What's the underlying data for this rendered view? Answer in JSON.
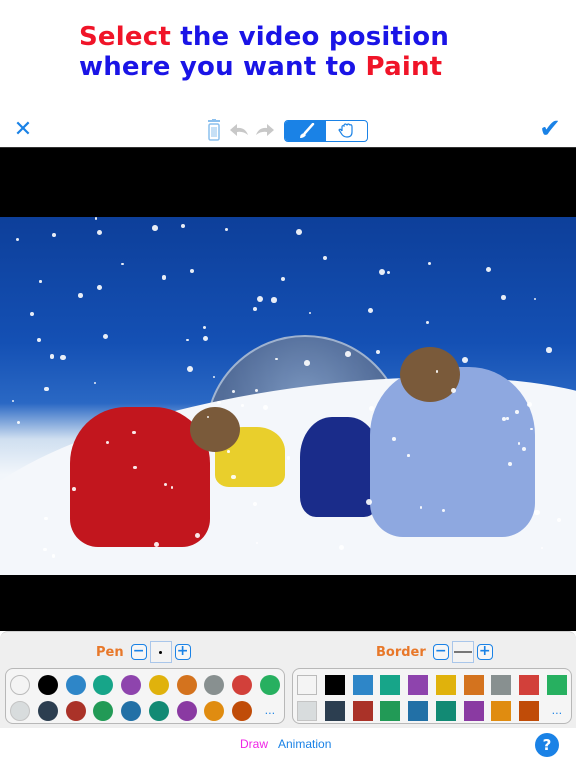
{
  "headline": {
    "line1_highlight": "Select",
    "line1_rest": " the video position",
    "line2_rest": "where you want to ",
    "line2_highlight": "Paint"
  },
  "toolbar": {
    "close_icon": "✕",
    "done_icon": "✔",
    "trash_label": "delete",
    "undo_label": "undo",
    "redo_label": "redo",
    "mode_brush": "brush",
    "mode_hand": "hand",
    "active_mode": "brush"
  },
  "video": {
    "description": "Children playing in snow on a hillside with a dome climbing frame and skis"
  },
  "pen": {
    "label": "Pen",
    "minus": "−",
    "plus": "+",
    "colors_row1": [
      "#f4f4f4",
      "#000000",
      "#2e86c8",
      "#17a589",
      "#8e44ad",
      "#e0b20c",
      "#d4731e",
      "#889090",
      "#d2403a",
      "#27b060"
    ],
    "colors_row2": [
      "#d8dcdd",
      "#2c3e50",
      "#aa3228",
      "#229a56",
      "#2270a6",
      "#128a74",
      "#8a3aa2",
      "#e08c10",
      "#c04c08"
    ],
    "more": "..."
  },
  "border": {
    "label": "Border",
    "minus": "−",
    "plus": "+",
    "colors_row1": [
      "#f4f4f4",
      "#000000",
      "#2e86c8",
      "#17a589",
      "#8e44ad",
      "#e0b20c",
      "#d4731e",
      "#889090",
      "#d2403a",
      "#27b060"
    ],
    "colors_row2": [
      "#d8dcdd",
      "#2c3e50",
      "#aa3228",
      "#229a56",
      "#2270a6",
      "#128a74",
      "#8a3aa2",
      "#e08c10",
      "#c04c08"
    ],
    "more": "..."
  },
  "tabs": {
    "draw": "Draw",
    "animation": "Animation",
    "active": "Draw"
  },
  "help": "?",
  "colors": {
    "accent": "#1a82e6",
    "headline_blue": "#1a14e6",
    "headline_red": "#f01428",
    "label_orange": "#e8782a",
    "draw_tab": "#f025e6"
  }
}
